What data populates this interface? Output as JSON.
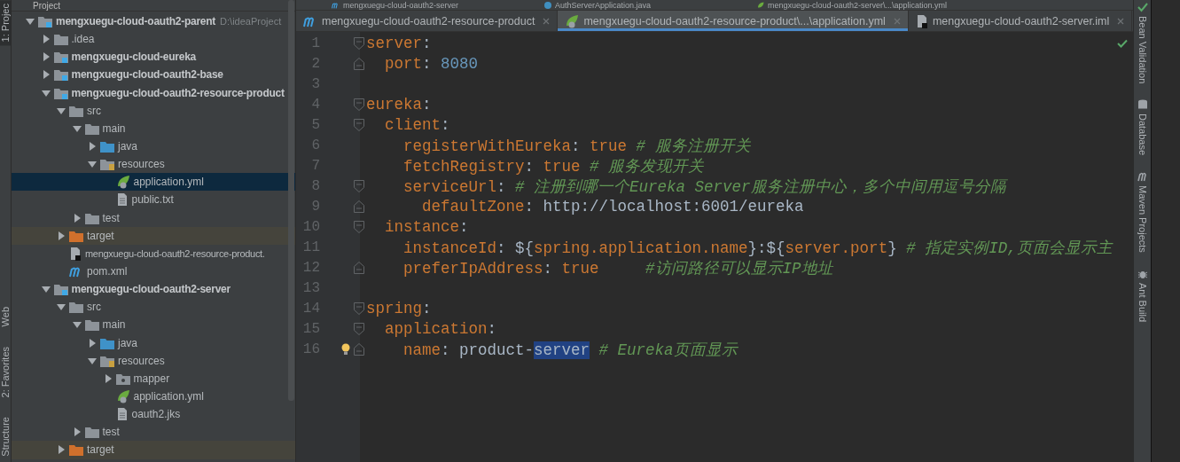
{
  "left_toolbar": [
    {
      "label": "1: Projec",
      "selected": true
    },
    {
      "label": "Web",
      "selected": false
    },
    {
      "label": "2: Favorites",
      "selected": false
    },
    {
      "label": "Structure",
      "selected": false
    }
  ],
  "project_panel": {
    "title": "Project",
    "tree": [
      {
        "label": "mengxuegu-cloud-oauth2-parent",
        "path": "D:\\ideaProject",
        "kind": "module",
        "expanded": true,
        "selected": false,
        "children": [
          {
            "label": ".idea",
            "kind": "folder",
            "expanded": false,
            "selected": false
          },
          {
            "label": "mengxuegu-cloud-eureka",
            "kind": "module",
            "expanded": false,
            "selected": false
          },
          {
            "label": "mengxuegu-cloud-oauth2-base",
            "kind": "module",
            "expanded": false,
            "selected": false
          },
          {
            "label": "mengxuegu-cloud-oauth2-resource-product",
            "kind": "module",
            "expanded": true,
            "selected": false,
            "children": [
              {
                "label": "src",
                "kind": "folder",
                "expanded": true,
                "selected": false,
                "children": [
                  {
                    "label": "main",
                    "kind": "folder",
                    "expanded": true,
                    "selected": false,
                    "children": [
                      {
                        "label": "java",
                        "kind": "source-folder",
                        "expanded": false,
                        "selected": false
                      },
                      {
                        "label": "resources",
                        "kind": "resources-folder",
                        "expanded": true,
                        "selected": false,
                        "children": [
                          {
                            "label": "application.yml",
                            "kind": "spring-file",
                            "selected": true
                          },
                          {
                            "label": "public.txt",
                            "kind": "text-file",
                            "selected": false
                          }
                        ]
                      }
                    ]
                  },
                  {
                    "label": "test",
                    "kind": "folder",
                    "expanded": false,
                    "selected": false
                  }
                ]
              },
              {
                "label": "target",
                "kind": "excluded-folder",
                "expanded": false,
                "selected": false
              },
              {
                "label": "mengxuegu-cloud-oauth2-resource-product.",
                "kind": "module-file",
                "selected": false
              },
              {
                "label": "pom.xml",
                "kind": "maven-file",
                "selected": false
              }
            ]
          },
          {
            "label": "mengxuegu-cloud-oauth2-server",
            "kind": "module",
            "expanded": true,
            "selected": false,
            "children": [
              {
                "label": "src",
                "kind": "folder",
                "expanded": true,
                "selected": false,
                "children": [
                  {
                    "label": "main",
                    "kind": "folder",
                    "expanded": true,
                    "selected": false,
                    "children": [
                      {
                        "label": "java",
                        "kind": "source-folder",
                        "expanded": false,
                        "selected": false
                      },
                      {
                        "label": "resources",
                        "kind": "resources-folder",
                        "expanded": true,
                        "selected": false,
                        "children": [
                          {
                            "label": "mapper",
                            "kind": "package",
                            "expanded": false,
                            "selected": false
                          },
                          {
                            "label": "application.yml",
                            "kind": "spring-file",
                            "selected": false
                          },
                          {
                            "label": "oauth2.jks",
                            "kind": "text-file",
                            "selected": false
                          }
                        ]
                      }
                    ]
                  },
                  {
                    "label": "test",
                    "kind": "folder",
                    "expanded": false,
                    "selected": false
                  }
                ]
              },
              {
                "label": "target",
                "kind": "excluded-folder",
                "expanded": false,
                "selected": false
              }
            ]
          }
        ]
      }
    ]
  },
  "editor": {
    "upper_tabs": [
      {
        "label": "mengxuegu-cloud-oauth2-server",
        "kind": "maven-file"
      },
      {
        "label": "AuthServerApplication.java",
        "kind": "java-file"
      },
      {
        "label": "mengxuegu-cloud-oauth2-server\\...\\application.yml",
        "kind": "spring-file"
      }
    ],
    "tabs": [
      {
        "label": "mengxuegu-cloud-oauth2-resource-product",
        "kind": "maven-file",
        "selected": false
      },
      {
        "label": "mengxuegu-cloud-oauth2-resource-product\\...\\application.yml",
        "kind": "spring-file",
        "selected": true
      },
      {
        "label": "mengxuegu-cloud-oauth2-server.iml",
        "kind": "module-file",
        "selected": false
      }
    ],
    "lines": [
      {
        "number": "1",
        "kind": "fold-start",
        "segments": [
          {
            "t": "server",
            "kind": "key"
          },
          {
            "t": ":",
            "kind": "plain"
          }
        ]
      },
      {
        "number": "2",
        "kind": "fold-end",
        "segments": [
          {
            "t": "  port",
            "kind": "key"
          },
          {
            "t": ": ",
            "kind": "plain"
          },
          {
            "t": "8080",
            "kind": "number"
          }
        ]
      },
      {
        "number": "3",
        "kind": "plain"
      },
      {
        "number": "4",
        "kind": "fold-start",
        "segments": [
          {
            "t": "eureka",
            "kind": "key"
          },
          {
            "t": ":",
            "kind": "plain"
          }
        ]
      },
      {
        "number": "5",
        "kind": "fold-start",
        "segments": [
          {
            "t": "  client",
            "kind": "key"
          },
          {
            "t": ":",
            "kind": "plain"
          }
        ]
      },
      {
        "number": "6",
        "kind": "plain",
        "segments": [
          {
            "t": "    registerWithEureka",
            "kind": "key"
          },
          {
            "t": ": ",
            "kind": "plain"
          },
          {
            "t": "true ",
            "kind": "key"
          },
          {
            "t": "# 服务注册开关",
            "kind": "comment"
          }
        ]
      },
      {
        "number": "7",
        "kind": "plain",
        "segments": [
          {
            "t": "    fetchRegistry",
            "kind": "key"
          },
          {
            "t": ": ",
            "kind": "plain"
          },
          {
            "t": "true ",
            "kind": "key"
          },
          {
            "t": "# 服务发现开关",
            "kind": "comment"
          }
        ]
      },
      {
        "number": "8",
        "kind": "fold-start",
        "segments": [
          {
            "t": "    serviceUrl",
            "kind": "key"
          },
          {
            "t": ": ",
            "kind": "plain"
          },
          {
            "t": "# 注册到哪一个Eureka Server服务注册中心，多个中间用逗号分隔",
            "kind": "comment"
          }
        ]
      },
      {
        "number": "9",
        "kind": "fold-end",
        "segments": [
          {
            "t": "      defaultZone",
            "kind": "key"
          },
          {
            "t": ": http://localhost:6001/eureka",
            "kind": "plain"
          }
        ]
      },
      {
        "number": "10",
        "kind": "fold-start",
        "segments": [
          {
            "t": "  instance",
            "kind": "key"
          },
          {
            "t": ":",
            "kind": "plain"
          }
        ]
      },
      {
        "number": "11",
        "kind": "plain",
        "segments": [
          {
            "t": "    instanceId",
            "kind": "key"
          },
          {
            "t": ": ${",
            "kind": "plain"
          },
          {
            "t": "spring.application.name",
            "kind": "key"
          },
          {
            "t": "}:${",
            "kind": "plain"
          },
          {
            "t": "server.port",
            "kind": "key"
          },
          {
            "t": "} ",
            "kind": "plain"
          },
          {
            "t": "# 指定实例ID,页面会显示主",
            "kind": "comment"
          }
        ]
      },
      {
        "number": "12",
        "kind": "fold-end",
        "segments": [
          {
            "t": "    preferIpAddress",
            "kind": "key"
          },
          {
            "t": ": ",
            "kind": "plain"
          },
          {
            "t": "true     ",
            "kind": "key"
          },
          {
            "t": "#访问路径可以显示IP地址",
            "kind": "comment"
          }
        ]
      },
      {
        "number": "13",
        "kind": "plain"
      },
      {
        "number": "14",
        "kind": "fold-start",
        "segments": [
          {
            "t": "spring",
            "kind": "key"
          },
          {
            "t": ":",
            "kind": "plain"
          }
        ]
      },
      {
        "number": "15",
        "kind": "fold-start",
        "segments": [
          {
            "t": "  application",
            "kind": "key"
          },
          {
            "t": ":",
            "kind": "plain"
          }
        ]
      },
      {
        "number": "16",
        "kind": "fold-end",
        "intention_bulb": true,
        "segments": [
          {
            "t": "    name",
            "kind": "key"
          },
          {
            "t": ": product-",
            "kind": "plain"
          },
          {
            "t": "server",
            "kind": "selection"
          },
          {
            "t": " # Eureka页面显示",
            "kind": "comment"
          }
        ]
      }
    ]
  },
  "right_toolbar": [
    {
      "label": "Bean Validation",
      "kind": "bean"
    },
    {
      "label": "Database",
      "kind": "database"
    },
    {
      "label": "Maven Projects",
      "kind": "maven"
    },
    {
      "label": "Ant Build",
      "kind": "ant"
    }
  ]
}
